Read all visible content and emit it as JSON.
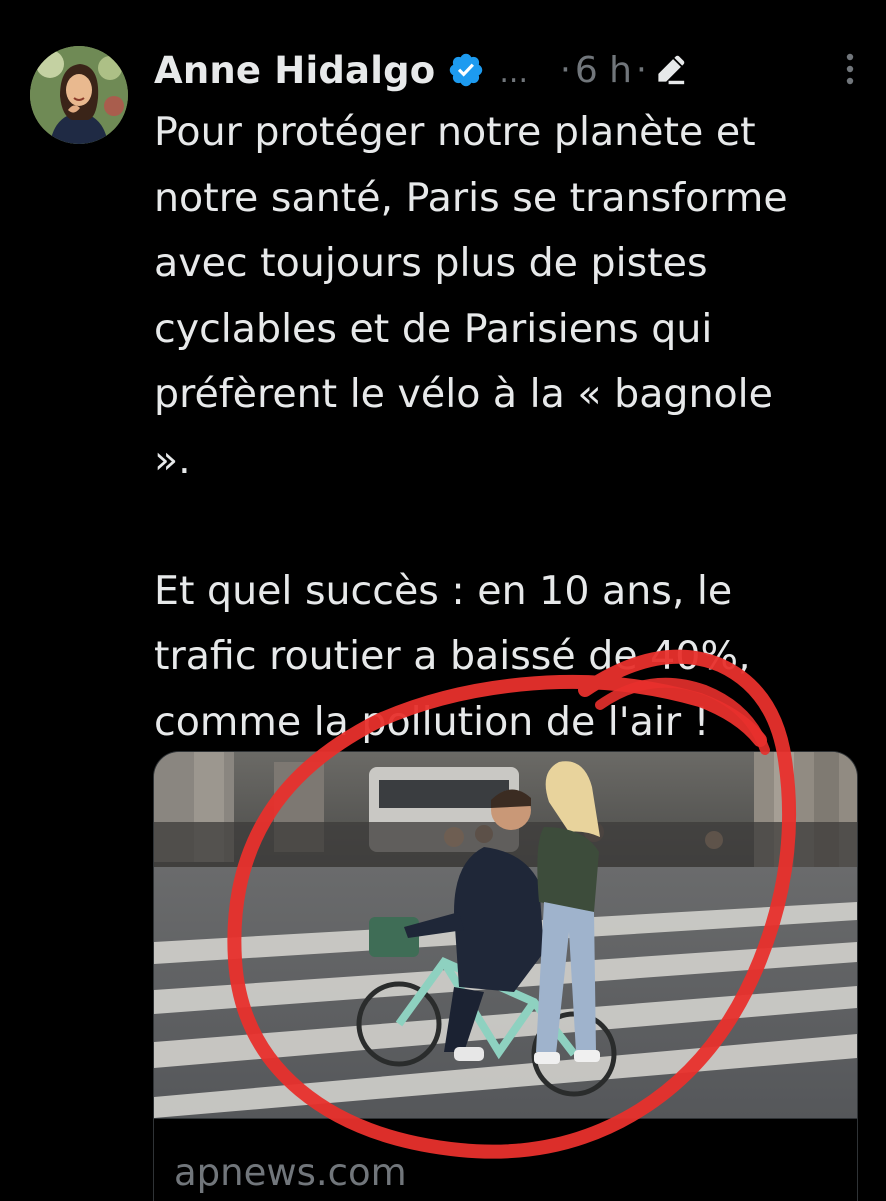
{
  "tweet": {
    "author_name": "Anne Hidalgo",
    "handle_truncated": "...",
    "separator": "·",
    "time": "6 h",
    "text_lines": [
      "Pour protéger notre planète et",
      "notre santé, Paris se transforme",
      "avec toujours plus de pistes",
      "cyclables et de Parisiens qui",
      "préfèrent le vélo à la « bagnole",
      "»."
    ],
    "text_lines_2": [
      "Et quel succès : en 10 ans, le",
      "trafic routier a baissé de 40%,",
      "comme la pollution de l'air !"
    ],
    "card": {
      "domain": "apnews.com"
    }
  },
  "icons": {
    "verified": "verified-badge-icon",
    "edited": "pencil-edit-icon",
    "more": "more-vertical-icon"
  },
  "colors": {
    "background": "#000000",
    "text_primary": "#e7e9ea",
    "text_secondary": "#71767b",
    "verified_blue": "#1d9bf0",
    "annotation_red": "#e8302c"
  }
}
